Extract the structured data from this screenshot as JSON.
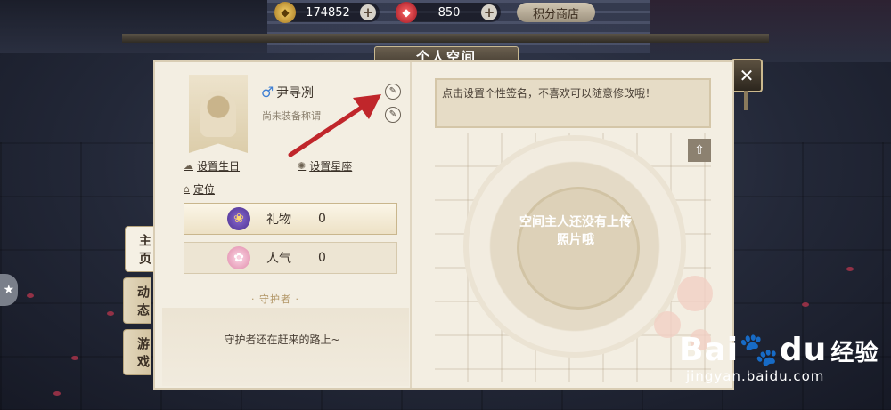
{
  "resources": {
    "gold_value": "174852",
    "gem_value": "850",
    "shop_label": "积分商店"
  },
  "panel": {
    "title": "个人空间",
    "close_label": "✕"
  },
  "profile": {
    "gender_symbol": "♂",
    "name": "尹寻冽",
    "title_hint": "尚未装备称谓",
    "set_birthday": "设置生日",
    "set_constellation": "设置星座",
    "location": "定位"
  },
  "stats": [
    {
      "label": "礼物",
      "value": "0",
      "icon": "gift-bag-icon"
    },
    {
      "label": "人气",
      "value": "0",
      "icon": "flower-icon"
    }
  ],
  "guardian": {
    "title": "守护者",
    "message": "守护者还在赶来的路上~"
  },
  "tabs": [
    "主页",
    "动态",
    "游戏"
  ],
  "signature": {
    "placeholder": "点击设置个性签名，不喜欢可以随意修改哦！"
  },
  "photo": {
    "empty_message": "空间主人还没有上传照片哦"
  },
  "watermark": {
    "brand": "Bai",
    "brand2": "du",
    "brand_cn": "经验",
    "url": "jingyan.baidu.com"
  },
  "colors": {
    "panel_bg": "#f3eee2",
    "accent_arrow": "#c0262b",
    "gender_blue": "#3f7fd3"
  }
}
